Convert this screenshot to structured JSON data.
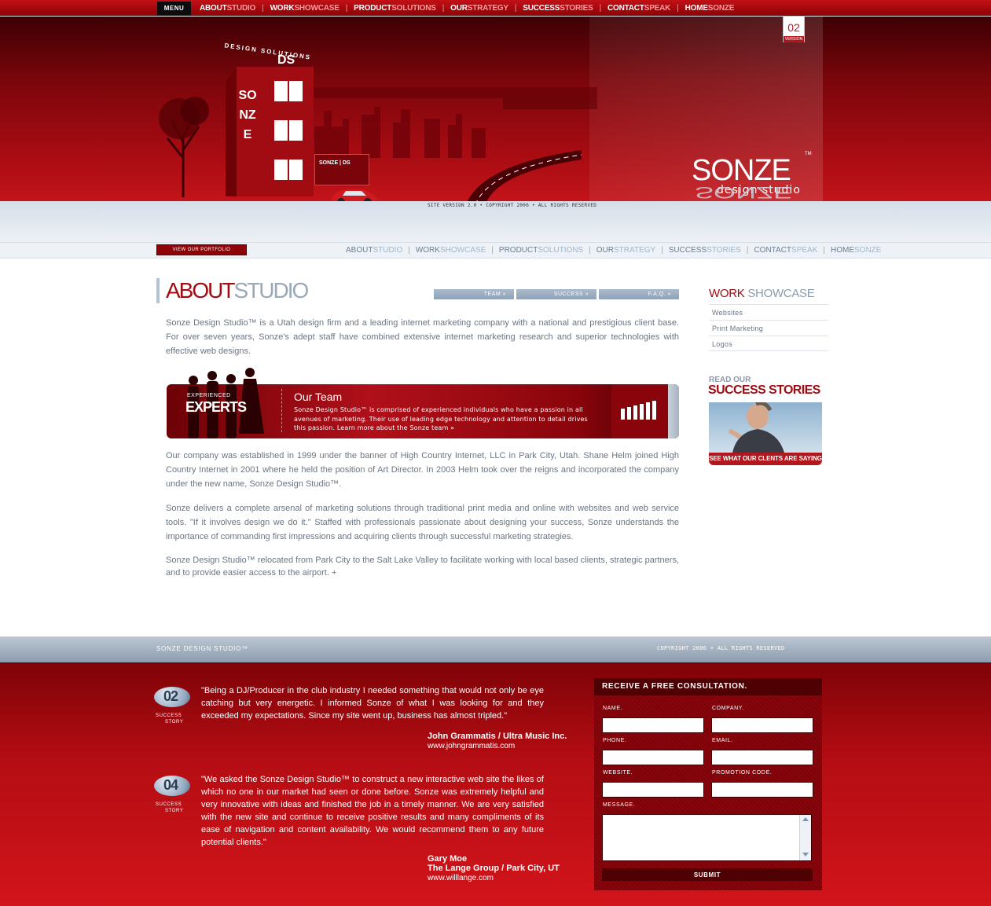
{
  "topbar": {
    "menu_label": "MENU",
    "items": [
      {
        "a": "ABOUT",
        "b": "STUDIO"
      },
      {
        "a": "WORK",
        "b": "SHOWCASE"
      },
      {
        "a": "PRODUCT",
        "b": "SOLUTIONS"
      },
      {
        "a": "OUR",
        "b": "STRATEGY"
      },
      {
        "a": "SUCCESS",
        "b": "STORIES"
      },
      {
        "a": "CONTACT",
        "b": "SPEAK"
      },
      {
        "a": "HOME",
        "b": "SONZE"
      }
    ]
  },
  "hero": {
    "design_solutions": "DESIGN SOLUTIONS",
    "building_letters": "DS",
    "building_sign": "SONZE",
    "billboard": "SONZE | DS",
    "version_number": "02",
    "version_label": "VERSION",
    "brand": "SONZE",
    "brand_sub": "design studio",
    "trademark": "TM",
    "copyright": "SITE VERSION 2.0  •  COPYRIGHT 2006  •  ALL RIGHTS RESERVED"
  },
  "subbar": {
    "portfolio_button": "VIEW OUR PORTFOLIO",
    "items": [
      {
        "a": "ABOUT",
        "b": "STUDIO"
      },
      {
        "a": "WORK",
        "b": "SHOWCASE"
      },
      {
        "a": "PRODUCT",
        "b": "SOLUTIONS"
      },
      {
        "a": "OUR",
        "b": "STRATEGY"
      },
      {
        "a": "SUCCESS",
        "b": "STORIES"
      },
      {
        "a": "CONTACT",
        "b": "SPEAK"
      },
      {
        "a": "HOME",
        "b": "SONZE"
      }
    ]
  },
  "main": {
    "title_a": "ABOUT",
    "title_b": "STUDIO",
    "tabs": [
      "TEAM »",
      "SUCCESS »",
      "F.A.Q. »"
    ],
    "para1": "Sonze Design Studio™ is a Utah design firm and a leading internet marketing company with a national and prestigious client base. For over seven years, Sonze's adept staff have combined extensive internet marketing research and superior technologies with effective web designs.",
    "team_banner": {
      "small": "EXPERIENCED",
      "big": "EXPERTS",
      "title": "Our Team",
      "desc": "Sonze Design Studio™ is comprised of experienced individuals who have a passion in all avenues of marketing. Their use of leading edge technology and attention to detail drives this passion.  Learn more about the Sonze team »"
    },
    "para2": "Our company was established in 1999 under the banner of High Country Internet, LLC in Park City, Utah. Shane Helm joined High Country Internet in 2001 where he held the position of Art Director. In 2003 Helm took over the reigns and incorporated the company under the new name, Sonze Design Studio™.",
    "para3": "Sonze delivers a complete arsenal of marketing solutions through traditional print media and online with websites and web service tools. \"If it involves design we do it.\" Staffed with professionals passionate about designing your success, Sonze understands the importance of commanding first impressions and acquiring clients through successful marketing strategies.",
    "para4": "Sonze Design Studio™ relocated from Park City to the Salt Lake Valley to facilitate working with local based clients, strategic partners, and to provide easier access to the airport. +"
  },
  "sidebar": {
    "work_a": "WORK",
    "work_b": "SHOWCASE",
    "work_items": [
      "Websites",
      "Print Marketing",
      "Logos"
    ],
    "read_our": "READ OUR",
    "success_title": "SUCCESS STORIES",
    "success_caption": "SEE WHAT OUR CLENTS ARE SAYING"
  },
  "footer": {
    "brand": "SONZE DESIGN STUDIO™",
    "copyright": "COPYRIGHT 2006  +  ALL RIGHTS RESERVED"
  },
  "stories": [
    {
      "number": "02",
      "label1": "SUCCESS",
      "label2": "STORY",
      "quote": "\"Being a DJ/Producer in the club industry I needed something that would not only be eye catching but very energetic. I informed Sonze of what I was looking for and they exceeded my expectations. Since my site went up, business has almost tripled.\"",
      "author": "John Grammatis / Ultra Music Inc.",
      "author2": "",
      "url": "www.johngrammatis.com"
    },
    {
      "number": "04",
      "label1": "SUCCESS",
      "label2": "STORY",
      "quote": "\"We asked the Sonze Design Studio™ to construct a new interactive web site the likes of which no one in our market had seen or done before. Sonze was extremely helpful and very innovative with ideas and finished the job in a timely manner. We are very satisfied with the new site and continue to receive positive results and many compliments of its ease of navigation and content availability. We would recommend them to any future potential clients.\"",
      "author": "Gary Moe",
      "author2": "The Lange Group / Park City, UT",
      "url": "www.willlange.com"
    }
  ],
  "form": {
    "title": "RECEIVE A FREE CONSULTATION.",
    "name": "NAME.",
    "company": "COMPANY.",
    "phone": "PHONE.",
    "email": "EMAIL.",
    "website": "WEBSITE.",
    "promo": "PROMOTION CODE.",
    "message": "MESSAGE.",
    "submit": "SUBMIT"
  },
  "colors": {
    "brand_red": "#a10c12",
    "nav_blue": "#8fa2b7",
    "text_gray": "#6b7583"
  }
}
